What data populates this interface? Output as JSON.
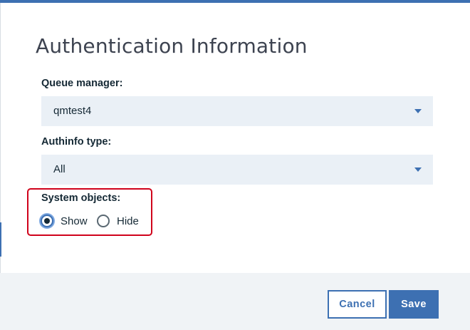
{
  "dialog": {
    "title": "Authentication Information"
  },
  "queue_manager": {
    "label": "Queue manager:",
    "value": "qmtest4"
  },
  "authinfo_type": {
    "label": "Authinfo type:",
    "value": "All"
  },
  "system_objects": {
    "label": "System objects:",
    "options": [
      {
        "label": "Show",
        "checked": true
      },
      {
        "label": "Hide",
        "checked": false
      }
    ],
    "highlight_color": "#d0021b"
  },
  "footer": {
    "cancel_label": "Cancel",
    "save_label": "Save"
  },
  "colors": {
    "accent": "#3d70b2",
    "field_background": "#eaf0f6",
    "footer_background": "#f0f3f6",
    "text": "#152935"
  }
}
